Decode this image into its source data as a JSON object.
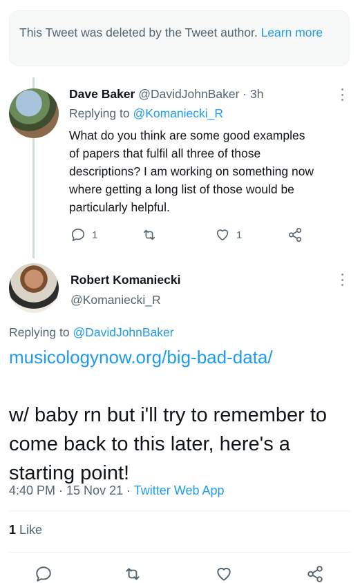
{
  "deleted_notice": {
    "text": "This Tweet was deleted by the Tweet author.",
    "link": "Learn more"
  },
  "reply_tweet": {
    "author_name": "Dave Baker",
    "handle": "@DavidJohnBaker",
    "time": "· 3h",
    "replying_prefix": "Replying to",
    "replying_to": "@Komaniecki_R",
    "lines": [
      "What do you think are some good examples",
      "of papers that fulfil all three of those",
      "descriptions? I am working on something now",
      "where getting a long list of those would be",
      "particularly helpful."
    ],
    "reply_count": "1",
    "like_count": "1"
  },
  "main_tweet": {
    "author_name": "Robert Komaniecki",
    "handle": "@Komaniecki_R",
    "replying_prefix": "Replying to",
    "replying_to": "@DavidJohnBaker",
    "link": "musicologynow.org/big-bad-data/",
    "text": "w/ baby rn but i'll try to remember to come back to this later, here's a starting point!",
    "time": "4:40 PM · 15 Nov 21 ·",
    "source": "Twitter Web App",
    "likes_count": "1",
    "likes_label": "Like"
  },
  "colors": {
    "accent": "#1d9bf0",
    "muted": "#536471",
    "text": "#0f1419"
  },
  "icons": {
    "reply": "reply-icon",
    "retweet": "retweet-icon",
    "like": "heart-icon",
    "share": "share-icon",
    "more": "more-vertical-icon"
  }
}
